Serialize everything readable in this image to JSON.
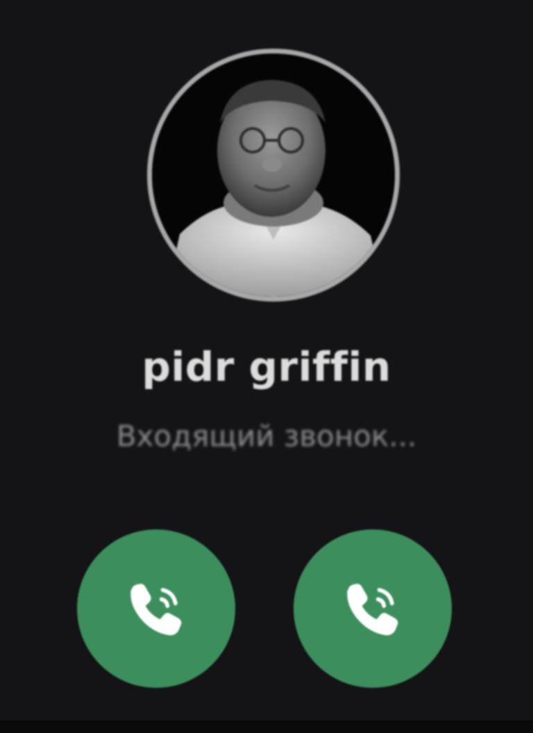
{
  "caller": {
    "name": "pidr griffin",
    "status": "Входящий звонок..."
  },
  "actions": {
    "left_button_icon": "phone-ringing-icon",
    "right_button_icon": "phone-ringing-icon"
  },
  "colors": {
    "background": "#141417",
    "accept_green": "#3c8f5c",
    "avatar_ring": "#a9a9a9",
    "name_text": "#dcdcdc",
    "status_text": "#8d8d8f"
  }
}
